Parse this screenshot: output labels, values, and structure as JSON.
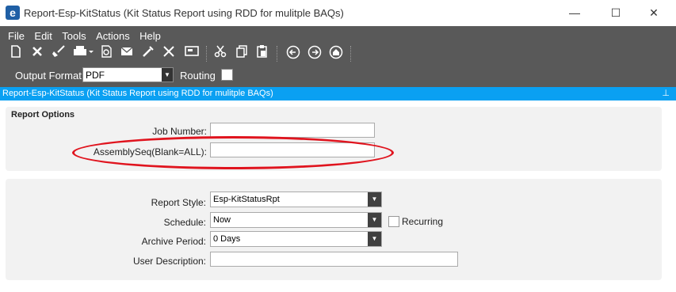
{
  "window": {
    "title": "Report-Esp-KitStatus (Kit Status Report using RDD for mulitple BAQs)",
    "logo_letter": "e",
    "minimize": "—",
    "maximize": "☐",
    "close": "✕"
  },
  "menu": [
    "File",
    "Edit",
    "Tools",
    "Actions",
    "Help"
  ],
  "toolbar_icons": [
    "new-icon",
    "delete-icon",
    "clear-icon",
    "print-icon",
    "print-preview-icon",
    "send-email-icon",
    "tools-icon",
    "wrench-icon",
    "screen-icon",
    "cut-icon",
    "copy-icon",
    "paste-icon",
    "back-icon",
    "forward-icon",
    "home-icon"
  ],
  "output": {
    "label": "Output Format:",
    "value": "PDF",
    "routing_label": "Routing",
    "routing_checked": false
  },
  "header": {
    "title": "Report-Esp-KitStatus (Kit Status Report using RDD for mulitple BAQs)",
    "pin": "⊥"
  },
  "report_options": {
    "title": "Report Options",
    "job_number_label": "Job Number:",
    "job_number_value": "",
    "assembly_label": "AssemblySeq(Blank=ALL):",
    "assembly_value": ""
  },
  "report_settings": {
    "style_label": "Report Style:",
    "style_value": "Esp-KitStatusRpt",
    "schedule_label": "Schedule:",
    "schedule_value": "Now",
    "recurring_label": "Recurring",
    "recurring_checked": false,
    "archive_label": "Archive Period:",
    "archive_value": "0 Days",
    "desc_label": "User Description:",
    "desc_value": ""
  }
}
